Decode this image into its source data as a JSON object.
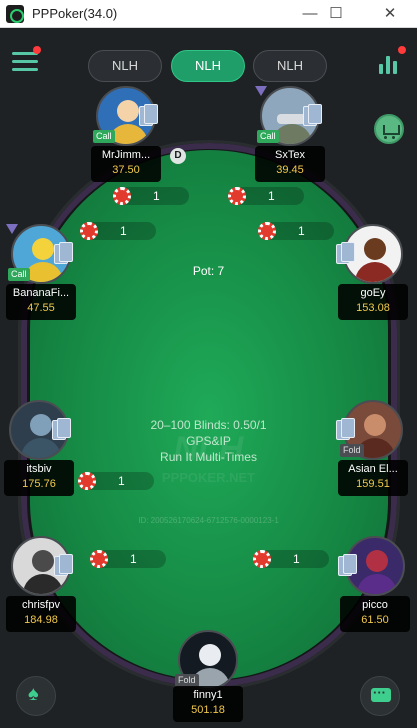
{
  "window": {
    "title": "PPPoker(34.0)",
    "minimize": "—",
    "maximize": "☐",
    "close": "✕"
  },
  "tabs": [
    {
      "label": "NLH",
      "active": false
    },
    {
      "label": "NLH",
      "active": true
    },
    {
      "label": "NLH",
      "active": false
    }
  ],
  "dealer_button": "D",
  "pot_label": "Pot: 7",
  "game_info": {
    "stakes": "20–100  Blinds: 0.50/1",
    "rule1": "GPS&IP",
    "rule2": "Run It Multi-Times"
  },
  "watermark": {
    "logo": "NLH",
    "site": "PPPOKER.NET"
  },
  "table_id": "ID: 200526170624-6712576-0000123-1",
  "players": [
    {
      "name": "MrJimm...",
      "stack": "37.50",
      "action": "Call",
      "avatar_icon": "king-avatar-icon"
    },
    {
      "name": "SxTex",
      "stack": "39.45",
      "action": "Call",
      "avatar_icon": "plane-avatar-icon"
    },
    {
      "name": "BananaFi...",
      "stack": "47.55",
      "action": "Call",
      "avatar_icon": "banana-avatar-icon"
    },
    {
      "name": "goEy",
      "stack": "153.08",
      "action": "",
      "avatar_icon": "samurai-avatar-icon"
    },
    {
      "name": "itsbiv",
      "stack": "175.76",
      "action": "",
      "avatar_icon": "hand-avatar-icon"
    },
    {
      "name": "Asian El...",
      "stack": "159.51",
      "action": "Fold",
      "avatar_icon": "portrait-avatar-icon"
    },
    {
      "name": "chrisfpv",
      "stack": "184.98",
      "action": "",
      "avatar_icon": "robot-avatar-icon"
    },
    {
      "name": "picco",
      "stack": "61.50",
      "action": "",
      "avatar_icon": "magneto-avatar-icon"
    },
    {
      "name": "finny1",
      "stack": "501.18",
      "action": "Fold",
      "avatar_icon": "astronaut-avatar-icon"
    }
  ],
  "bets": [
    "1",
    "1",
    "1",
    "1",
    "1",
    "1",
    "1"
  ],
  "colors": {
    "felt": "#168a45",
    "accent": "#2fc586",
    "stack": "#f2c94c",
    "chip": "#e23a2c"
  }
}
